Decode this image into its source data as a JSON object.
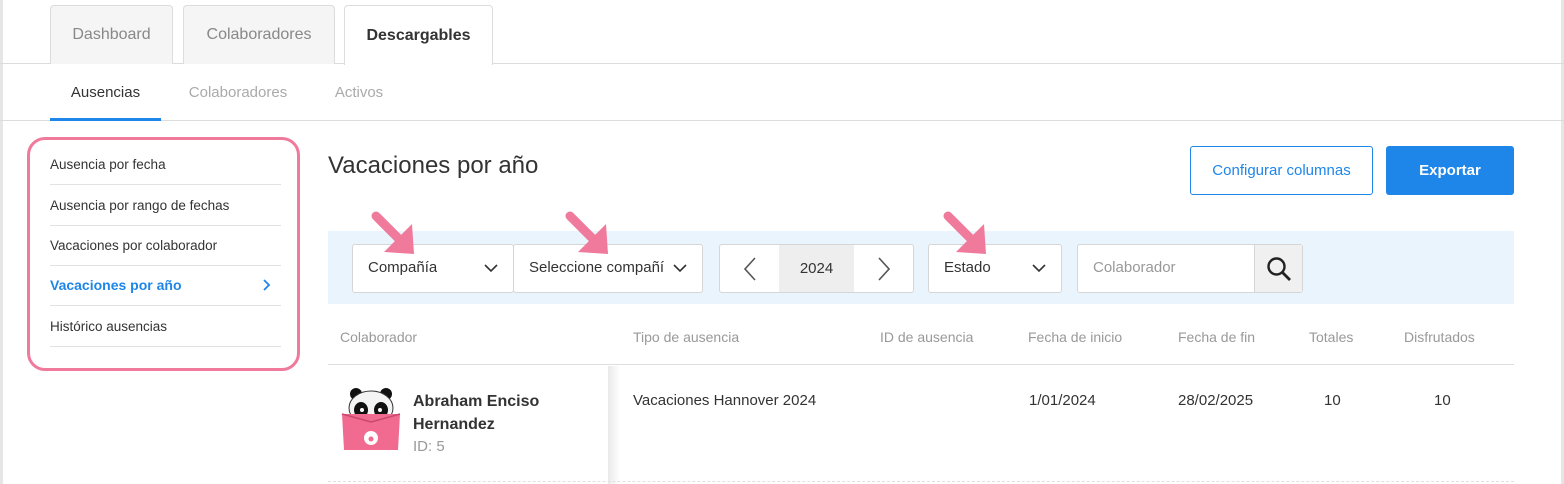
{
  "top_tabs": [
    "Dashboard",
    "Colaboradores",
    "Descargables"
  ],
  "sub_tabs": [
    "Ausencias",
    "Colaboradores",
    "Activos"
  ],
  "sidebar": {
    "items": [
      {
        "label": "Ausencia por fecha"
      },
      {
        "label": "Ausencia por rango de fechas"
      },
      {
        "label": "Vacaciones por colaborador"
      },
      {
        "label": "Vacaciones por año"
      },
      {
        "label": "Histórico ausencias"
      }
    ],
    "active_index": 3
  },
  "page": {
    "title": "Vacaciones por año",
    "configure_button": "Configurar columnas",
    "export_button": "Exportar"
  },
  "filters": {
    "company": "Compañía",
    "select_company": "Seleccione compañía",
    "year": "2024",
    "status": "Estado",
    "collaborator_placeholder": "Colaborador"
  },
  "table": {
    "headers": [
      "Colaborador",
      "Tipo de ausencia",
      "ID de ausencia",
      "Fecha de inicio",
      "Fecha de fin",
      "Totales",
      "Disfrutados"
    ],
    "rows": [
      {
        "name": "Abraham Enciso Hernandez",
        "id": "ID: 5",
        "absence_type": "Vacaciones Hannover 2024",
        "absence_id": "",
        "start": "1/01/2024",
        "end": "28/02/2025",
        "total": "10",
        "enjoyed": "10"
      }
    ]
  },
  "colors": {
    "accent": "#1e86e8",
    "highlight": "#f07a9c",
    "filter_bg": "#eaf4fd"
  }
}
